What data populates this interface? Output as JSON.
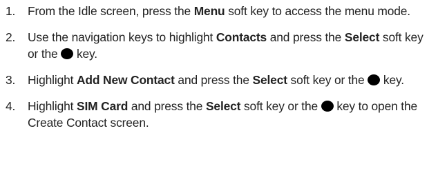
{
  "steps": [
    {
      "number": "1.",
      "parts": [
        {
          "text": "From the Idle screen, press the "
        },
        {
          "text": "Menu",
          "bold": true
        },
        {
          "text": " soft key to access the menu mode."
        }
      ]
    },
    {
      "number": "2.",
      "parts": [
        {
          "text": "Use the navigation keys to highlight "
        },
        {
          "text": "Contacts",
          "bold": true
        },
        {
          "text": " and press the "
        },
        {
          "text": "Select",
          "bold": true
        },
        {
          "text": " soft key or the "
        },
        {
          "icon": "black-circle-key-icon"
        },
        {
          "text": " key."
        }
      ]
    },
    {
      "number": "3.",
      "parts": [
        {
          "text": "Highlight "
        },
        {
          "text": "Add New Contact",
          "bold": true
        },
        {
          "text": " and press the "
        },
        {
          "text": "Select",
          "bold": true
        },
        {
          "text": " soft key or the "
        },
        {
          "icon": "black-circle-key-icon"
        },
        {
          "text": " key."
        }
      ]
    },
    {
      "number": "4.",
      "parts": [
        {
          "text": "Highlight "
        },
        {
          "text": "SIM Card",
          "bold": true
        },
        {
          "text": " and press the "
        },
        {
          "text": "Select",
          "bold": true
        },
        {
          "text": " soft key or the "
        },
        {
          "icon": "black-circle-key-icon"
        },
        {
          "text": " key to open the Create Contact screen."
        }
      ]
    }
  ]
}
